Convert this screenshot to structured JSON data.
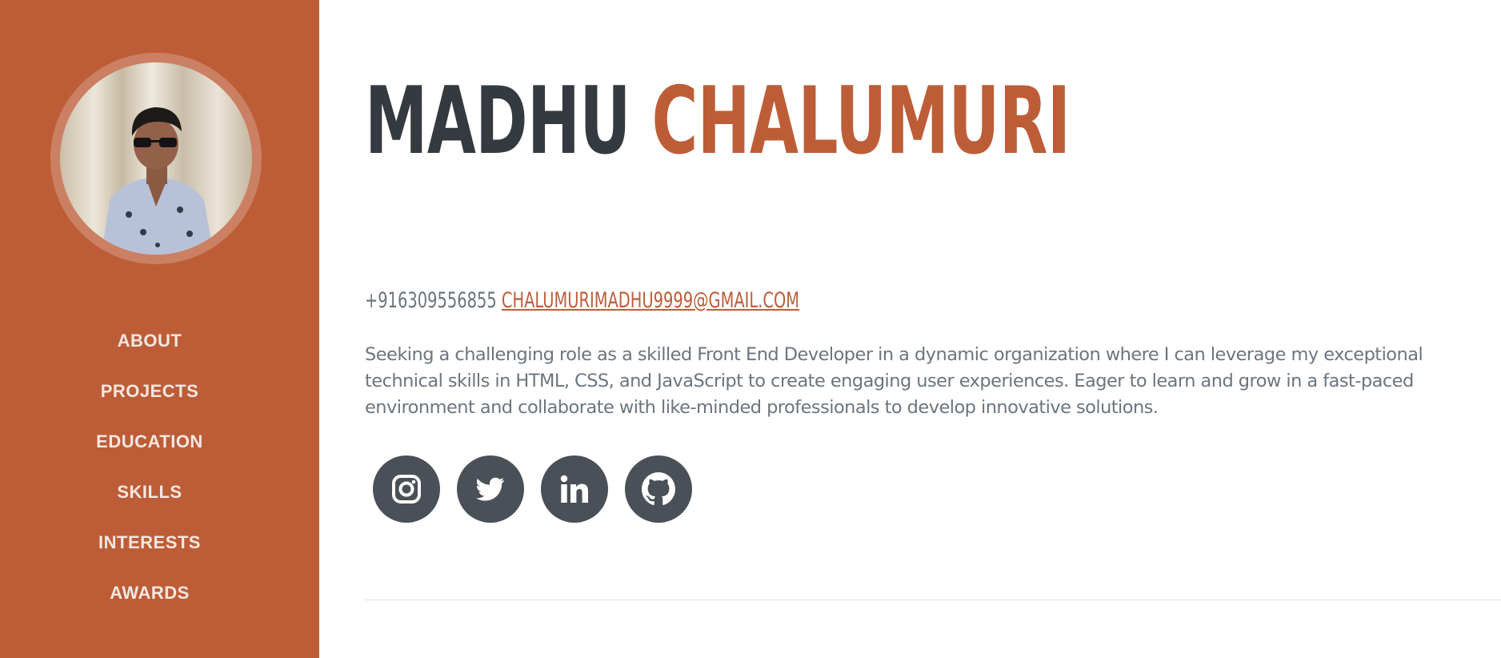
{
  "profile": {
    "first_name": "MADHU",
    "last_name": "CHALUMURI",
    "phone": "+916309556855",
    "email": "CHALUMURIMADHU9999@GMAIL.COM",
    "objective": "Seeking a challenging role as a skilled Front End Developer in a dynamic organization where I can leverage my exceptional technical skills in HTML, CSS, and JavaScript to create engaging user experiences. Eager to learn and grow in a fast-paced environment and collaborate with like-minded professionals to develop innovative solutions."
  },
  "sidebar": {
    "nav": [
      {
        "label": "ABOUT"
      },
      {
        "label": "PROJECTS"
      },
      {
        "label": "EDUCATION"
      },
      {
        "label": "SKILLS"
      },
      {
        "label": "INTERESTS"
      },
      {
        "label": "AWARDS"
      }
    ]
  },
  "socials": [
    {
      "icon": "instagram-icon"
    },
    {
      "icon": "twitter-icon"
    },
    {
      "icon": "linkedin-icon"
    },
    {
      "icon": "github-icon"
    }
  ],
  "colors": {
    "accent": "#bd5d38",
    "heading": "#343a40",
    "muted": "#6c757d",
    "social_bg": "#495057"
  }
}
